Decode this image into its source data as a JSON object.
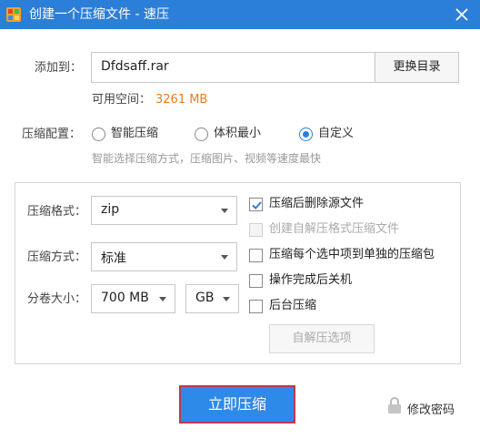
{
  "window": {
    "title": "创建一个压缩文件 - 速压"
  },
  "target": {
    "label": "添加到：",
    "value": "Dfdsaff.rar",
    "browse_label": "更换目录",
    "space_label": "可用空间：",
    "space_value": "3261 MB",
    "space_color": "#f07a17"
  },
  "config": {
    "label": "压缩配置：",
    "options": [
      {
        "label": "智能压缩",
        "selected": false
      },
      {
        "label": "体积最小",
        "selected": false
      },
      {
        "label": "自定义",
        "selected": true
      }
    ],
    "hint": "智能选择压缩方式，压缩图片、视频等速度最快"
  },
  "settings": {
    "format_label": "压缩格式：",
    "format_value": "zip",
    "method_label": "压缩方式：",
    "method_value": "标准",
    "split_label": "分卷大小：",
    "split_size": "700 MB",
    "split_unit": "GB"
  },
  "options": [
    {
      "label": "压缩后删除源文件",
      "checked": true,
      "enabled": true
    },
    {
      "label": "创建自解压格式压缩文件",
      "checked": false,
      "enabled": false
    },
    {
      "label": "压缩每个选中项到单独的压缩包",
      "checked": false,
      "enabled": true
    },
    {
      "label": "操作完成后关机",
      "checked": false,
      "enabled": true
    },
    {
      "label": "后台压缩",
      "checked": false,
      "enabled": true
    }
  ],
  "sfx_button_label": "自解压选项",
  "actions": {
    "compress_label": "立即压缩",
    "password_label": "修改密码"
  },
  "colors": {
    "titlebar": "#2b7fd8",
    "primary": "#2e8ae8",
    "check": "#2b7fd8"
  }
}
